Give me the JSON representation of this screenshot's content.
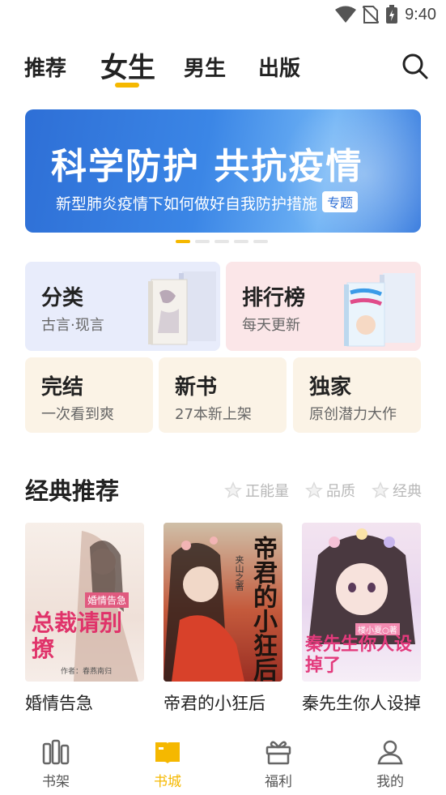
{
  "status": {
    "time": "9:40"
  },
  "tabs": [
    {
      "label": "推荐"
    },
    {
      "label": "女生"
    },
    {
      "label": "男生"
    },
    {
      "label": "出版"
    }
  ],
  "banner": {
    "title": "科学防护  共抗疫情",
    "subtitle": "新型肺炎疫情下如何做好自我防护措施",
    "tag": "专题"
  },
  "categories": {
    "fenlei": {
      "title": "分类",
      "sub": "古言·现言"
    },
    "rank": {
      "title": "排行榜",
      "sub": "每天更新"
    },
    "wanjie": {
      "title": "完结",
      "sub": "一次看到爽"
    },
    "xinshu": {
      "title": "新书",
      "sub": "27本新上架"
    },
    "dujia": {
      "title": "独家",
      "sub": "原创潜力大作"
    }
  },
  "section": {
    "title": "经典推荐",
    "filters": [
      "正能量",
      "品质",
      "经典"
    ]
  },
  "books": [
    {
      "name": "婚情告急",
      "cover_text": "总裁请别撩",
      "cover_tag": "婚情告急",
      "cover_author": "作者：春燕南归"
    },
    {
      "name": "帝君的小狂后",
      "cover_text": "帝君的小狂后",
      "cover_tag": "",
      "cover_author": "夹山之著"
    },
    {
      "name": "秦先生你人设掉了",
      "cover_text": "秦先生你人设掉了",
      "cover_tag": "",
      "cover_author": "楼小夏○著"
    }
  ],
  "nav": [
    {
      "label": "书架",
      "icon": "bookshelf-icon"
    },
    {
      "label": "书城",
      "icon": "book-city-icon"
    },
    {
      "label": "福利",
      "icon": "gift-icon"
    },
    {
      "label": "我的",
      "icon": "user-icon"
    }
  ],
  "colors": {
    "accent": "#f5b800",
    "banner": "#2e6fd6"
  }
}
